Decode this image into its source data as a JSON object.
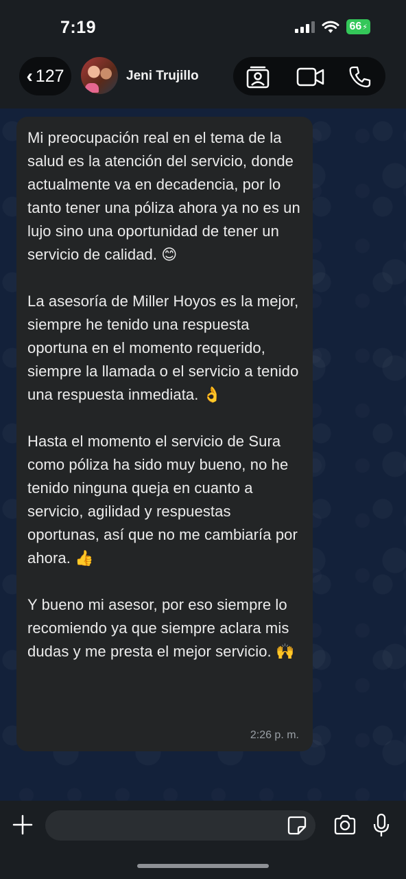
{
  "status_bar": {
    "time": "7:19",
    "battery": "66"
  },
  "header": {
    "back_count": "127",
    "contact_name": "Jeni Trujillo"
  },
  "message": {
    "paragraphs": [
      "Mi preocupación real en el tema de la salud es la atención del servicio, donde actualmente va en decadencia, por lo tanto tener una póliza ahora ya no es un lujo sino una oportunidad de tener un servicio de calidad. 😊",
      "La asesoría de Miller Hoyos es la mejor, siempre he tenido una respuesta oportuna en el momento requerido, siempre la llamada o el servicio a tenido una respuesta inmediata. 👌",
      "Hasta el momento el servicio de Sura como póliza ha sido muy bueno, no he tenido ninguna queja en cuanto a servicio, agilidad y respuestas oportunas, así que no me cambiaría por ahora. 👍",
      "Y bueno mi asesor, por eso siempre lo recomiendo ya que siempre aclara mis dudas y me presta el mejor servicio. 🙌"
    ],
    "timestamp": "2:26 p. m."
  },
  "icons": {
    "back": "chevron-left-icon",
    "contact_card": "contact-card-icon",
    "video": "video-camera-icon",
    "phone": "phone-icon",
    "plus": "plus-icon",
    "sticker": "sticker-icon",
    "camera": "camera-icon",
    "mic": "microphone-icon"
  },
  "colors": {
    "battery": "#34c759",
    "bubble": "#232526",
    "chat_bg": "#13213a"
  }
}
